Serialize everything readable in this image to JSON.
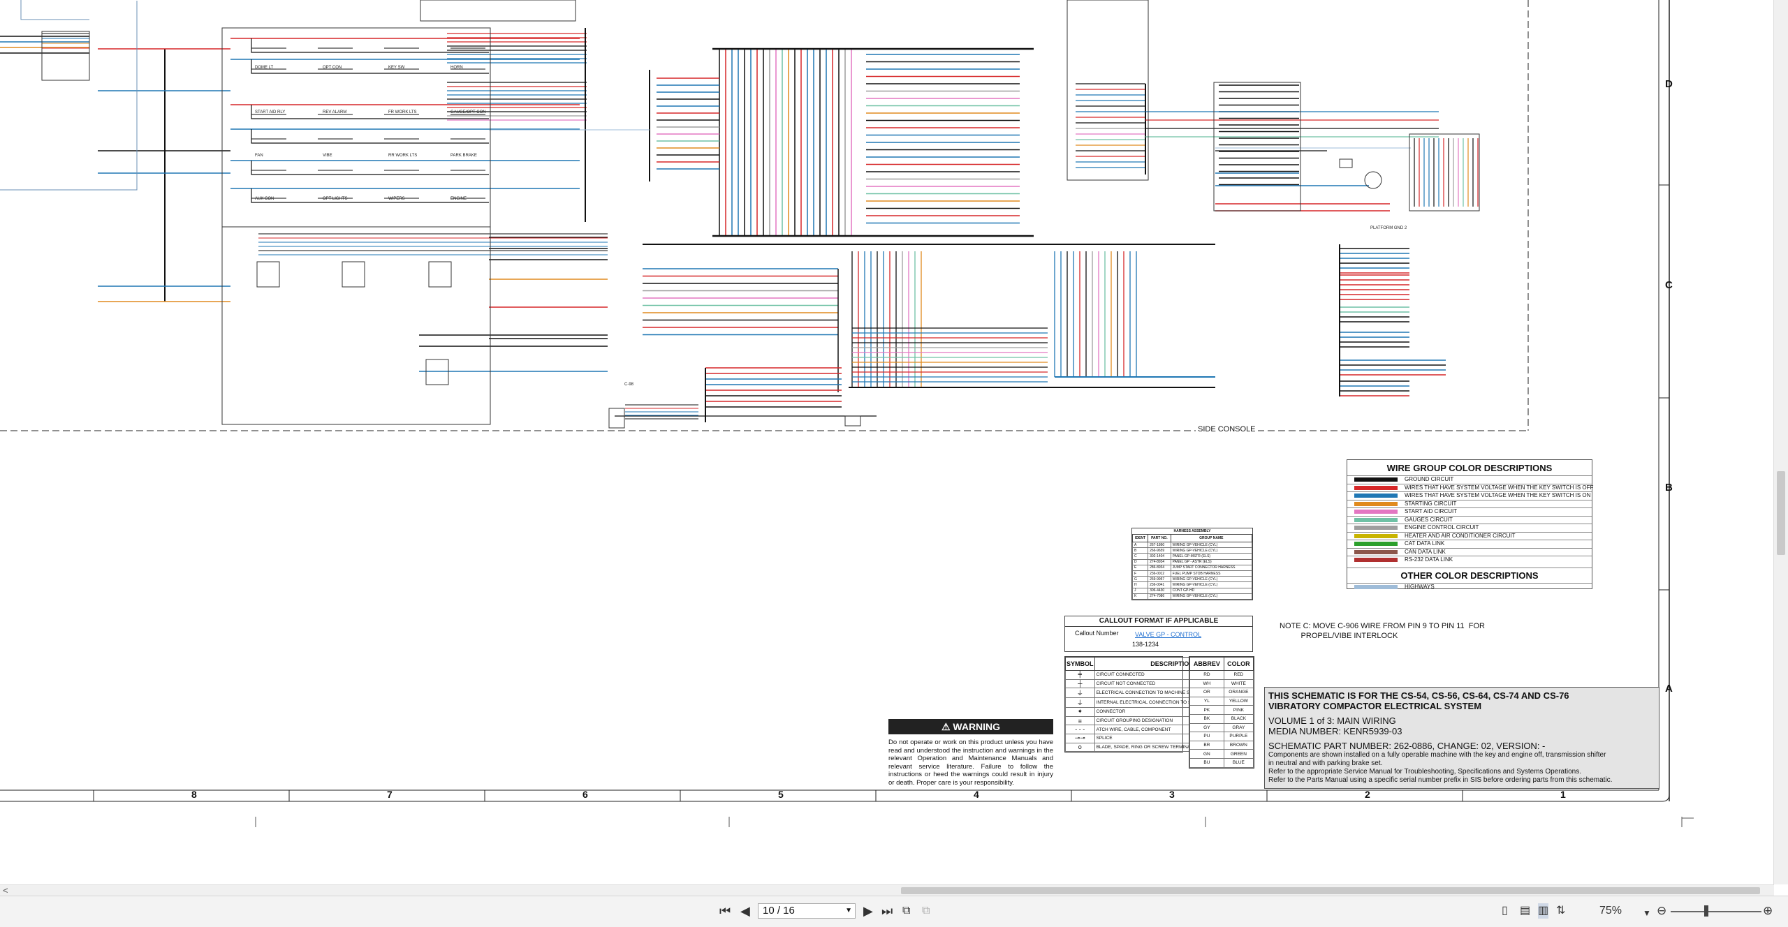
{
  "document": {
    "side_console_label": "SIDE CONSOLE",
    "column_numbers": [
      "8",
      "7",
      "6",
      "5",
      "4",
      "3",
      "2",
      "1"
    ],
    "row_letters": [
      "D",
      "C",
      "B",
      "A"
    ],
    "note_c": "NOTE C: MOVE C-906 WIRE FROM PIN 9 TO PIN 11  FOR\n          PROPEL/VIBE INTERLOCK",
    "wire_group": {
      "title": "WIRE GROUP COLOR DESCRIPTIONS",
      "rows": [
        {
          "label": "GROUND CIRCUIT",
          "color": "#111111"
        },
        {
          "label": "WIRES THAT HAVE SYSTEM VOLTAGE WHEN THE KEY SWITCH IS OFF",
          "color": "#d62728"
        },
        {
          "label": "WIRES THAT HAVE SYSTEM VOLTAGE WHEN THE KEY SWITCH IS ON",
          "color": "#1f77b4"
        },
        {
          "label": "STARTING CIRCUIT",
          "color": "#e08a1e"
        },
        {
          "label": "START AID CIRCUIT",
          "color": "#e377c2"
        },
        {
          "label": "GAUGES CIRCUIT",
          "color": "#6fc1a5"
        },
        {
          "label": "ENGINE CONTROL CIRCUIT",
          "color": "#9e9e9e"
        },
        {
          "label": "HEATER AND AIR CONDITIONER CIRCUIT",
          "color": "#c8b400"
        },
        {
          "label": "CAT DATA LINK",
          "color": "#2ca02c"
        },
        {
          "label": "CAN DATA LINK",
          "color": "#8c564b"
        },
        {
          "label": "RS-232 DATA LINK",
          "color": "#b03030"
        }
      ],
      "other_title": "OTHER COLOR DESCRIPTIONS",
      "other_rows": [
        {
          "label": "HIGHWAYS",
          "color": "#9fbcd8"
        }
      ]
    },
    "callout": {
      "title": "CALLOUT FORMAT IF APPLICABLE",
      "callout_number": "Callout Number",
      "component_name": "VALVE GP - CONTROL",
      "part_number": "138-1234"
    },
    "symbols": {
      "headers": [
        "SYMBOL",
        "DESCRIPTION"
      ],
      "rows": [
        {
          "symbol": "┿",
          "desc": "CIRCUIT CONNECTED"
        },
        {
          "symbol": "┼",
          "desc": "CIRCUIT NOT CONNECTED"
        },
        {
          "symbol": "⏚",
          "desc": "ELECTRICAL CONNECTION TO MACHINE STRUCTURE"
        },
        {
          "symbol": "⏚",
          "desc": "INTERNAL ELECTRICAL CONNECTION TO SURFACE OF COMPONENT"
        },
        {
          "symbol": "✦",
          "desc": "CONNECTOR"
        },
        {
          "symbol": "≡",
          "desc": "CIRCUIT GROUPING DESIGNATION"
        },
        {
          "symbol": "- - -",
          "desc": "ATCH WIRE, CABLE, COMPONENT"
        },
        {
          "symbol": "⊸⊸",
          "desc": "SPLICE"
        },
        {
          "symbol": "o",
          "desc": "BLADE, SPADE, RING OR SCREW TERMINAL"
        }
      ]
    },
    "abbrev": {
      "headers": [
        "ABBREV",
        "COLOR"
      ],
      "rows": [
        [
          "RD",
          "RED"
        ],
        [
          "WH",
          "WHITE"
        ],
        [
          "OR",
          "ORANGE"
        ],
        [
          "YL",
          "YELLOW"
        ],
        [
          "PK",
          "PINK"
        ],
        [
          "BK",
          "BLACK"
        ],
        [
          "GY",
          "GRAY"
        ],
        [
          "PU",
          "PURPLE"
        ],
        [
          "BR",
          "BROWN"
        ],
        [
          "GN",
          "GREEN"
        ],
        [
          "BU",
          "BLUE"
        ]
      ]
    },
    "harness": {
      "title": "HARNESS ASSEMBLY",
      "headers": [
        "IDENT",
        "PART NO.",
        "GROUP NAME"
      ],
      "rows": [
        [
          "A",
          "267-1860",
          "WIRING GP-VEHICLE (CYL)"
        ],
        [
          "B",
          "266-9659",
          "WIRING GP-VEHICLE (CYL)"
        ],
        [
          "C",
          "302-1404",
          "PANEL GP-MSTR (ELS)"
        ],
        [
          "D",
          "274-8934",
          "PANEL GP - ASTR (ELS)"
        ],
        [
          "E",
          "286-8934",
          "JUMP START CONNECTOR HARNESS"
        ],
        [
          "F",
          "236-0012",
          "FUEL PUMP STOB HARNESS"
        ],
        [
          "G",
          "269-9957",
          "WIRING GP-VEHICLE (CYL)"
        ],
        [
          "H",
          "236-0041",
          "WIRING GP-VEHICLE (CYL)"
        ],
        [
          "J",
          "306-4430",
          "CONT GP-HD"
        ],
        [
          "K",
          "274-7086",
          "WIRING GP-VEHICLE (CYL)"
        ]
      ]
    },
    "warning": {
      "title": "WARNING",
      "body": "Do not operate or work on this product unless you have read and understood the instruction and warnings in the relevant Operation and Maintenance Manuals and relevant service literature. Failure to follow the instructions or heed the warnings could result in injury or death. Proper care is your responsibility."
    },
    "title_block": {
      "line1": "THIS SCHEMATIC IS FOR THE CS-54, CS-56, CS-64, CS-74 AND CS-76",
      "line2": "VIBRATORY COMPACTOR ELECTRICAL SYSTEM",
      "line3": "VOLUME 1 of 3: MAIN WIRING",
      "line4": "MEDIA NUMBER: KENR5939-03",
      "line5": "SCHEMATIC PART NUMBER: 262-0886, CHANGE: 02, VERSION: -",
      "line6": "Components are shown installed on a fully operable machine with the key and engine off, transmission shifter",
      "line7": "in neutral and with parking brake set.",
      "line8": "Refer to the appropriate Service Manual for Troubleshooting, Specifications and Systems Operations.",
      "line9": "Refer to the Parts Manual using a specific serial number prefix in SIS before ordering parts from this schematic."
    },
    "components": {
      "switches": [
        "DOME LT",
        "OPT CON",
        "KEY SW",
        "HORN",
        "START AID RLY",
        "REV ALARM",
        "FR WORK LTS",
        "GAUGE/OPT CON",
        "FAN",
        "VIBE",
        "RR WORK LTS",
        "PARK BRAKE",
        "AUX CON",
        "OPT LIGHTS",
        "WIPERS",
        "ENGINE"
      ],
      "platform_gnd": "PLATFORM GND 2",
      "connector_c98": "C-98"
    }
  },
  "toolbar": {
    "page_value": "10 / 16",
    "zoom": "75%"
  }
}
